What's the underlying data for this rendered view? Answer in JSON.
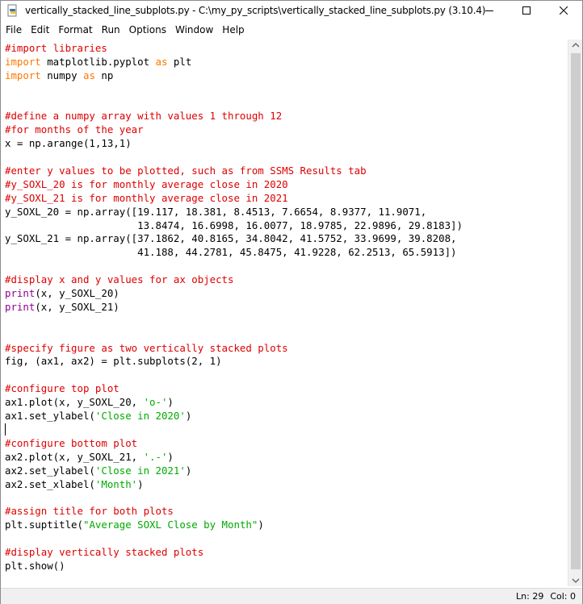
{
  "window": {
    "title": "vertically_stacked_line_subplots.py - C:\\my_py_scripts\\vertically_stacked_line_subplots.py (3.10.4)",
    "icon": "python-file-icon"
  },
  "menu": [
    {
      "id": "file",
      "label": "File"
    },
    {
      "id": "edit",
      "label": "Edit"
    },
    {
      "id": "format",
      "label": "Format"
    },
    {
      "id": "run",
      "label": "Run"
    },
    {
      "id": "options",
      "label": "Options"
    },
    {
      "id": "window",
      "label": "Window"
    },
    {
      "id": "help",
      "label": "Help"
    }
  ],
  "colors": {
    "comment": "#dd0000",
    "keyword": "#ff7700",
    "builtin": "#900090",
    "string": "#00aa00",
    "default": "#000000"
  },
  "code": [
    [
      [
        "comment",
        "#import libraries"
      ]
    ],
    [
      [
        "keyword",
        "import"
      ],
      [
        "default",
        " matplotlib.pyplot "
      ],
      [
        "keyword",
        "as"
      ],
      [
        "default",
        " plt"
      ]
    ],
    [
      [
        "keyword",
        "import"
      ],
      [
        "default",
        " numpy "
      ],
      [
        "keyword",
        "as"
      ],
      [
        "default",
        " np"
      ]
    ],
    [],
    [],
    [
      [
        "comment",
        "#define a numpy array with values 1 through 12"
      ]
    ],
    [
      [
        "comment",
        "#for months of the year"
      ]
    ],
    [
      [
        "default",
        "x = np.arange(1,13,1)"
      ]
    ],
    [],
    [
      [
        "comment",
        "#enter y values to be plotted, such as from SSMS Results tab"
      ]
    ],
    [
      [
        "comment",
        "#y_SOXL_20 is for monthly average close in 2020"
      ]
    ],
    [
      [
        "comment",
        "#y_SOXL_21 is for monthly average close in 2021"
      ]
    ],
    [
      [
        "default",
        "y_SOXL_20 = np.array([19.117, 18.381, 8.4513, 7.6654, 8.9377, 11.9071,"
      ]
    ],
    [
      [
        "default",
        "                      13.8474, 16.6998, 16.0077, 18.9785, 22.9896, 29.8183])"
      ]
    ],
    [
      [
        "default",
        "y_SOXL_21 = np.array([37.1862, 40.8165, 34.8042, 41.5752, 33.9699, 39.8208,"
      ]
    ],
    [
      [
        "default",
        "                      41.188, 44.2781, 45.8475, 41.9228, 62.2513, 65.5913])"
      ]
    ],
    [],
    [
      [
        "comment",
        "#display x and y values for ax objects"
      ]
    ],
    [
      [
        "builtin",
        "print"
      ],
      [
        "default",
        "(x, y_SOXL_20)"
      ]
    ],
    [
      [
        "builtin",
        "print"
      ],
      [
        "default",
        "(x, y_SOXL_21)"
      ]
    ],
    [],
    [],
    [
      [
        "comment",
        "#specify figure as two vertically stacked plots"
      ]
    ],
    [
      [
        "default",
        "fig, (ax1, ax2) = plt.subplots(2, 1)"
      ]
    ],
    [],
    [
      [
        "comment",
        "#configure top plot"
      ]
    ],
    [
      [
        "default",
        "ax1.plot(x, y_SOXL_20, "
      ],
      [
        "string",
        "'o-'"
      ],
      [
        "default",
        ")"
      ]
    ],
    [
      [
        "default",
        "ax1.set_ylabel("
      ],
      [
        "string",
        "'Close in 2020'"
      ],
      [
        "default",
        ")"
      ]
    ],
    [
      [
        "caret",
        ""
      ]
    ],
    [
      [
        "comment",
        "#configure bottom plot"
      ]
    ],
    [
      [
        "default",
        "ax2.plot(x, y_SOXL_21, "
      ],
      [
        "string",
        "'.-'"
      ],
      [
        "default",
        ")"
      ]
    ],
    [
      [
        "default",
        "ax2.set_ylabel("
      ],
      [
        "string",
        "'Close in 2021'"
      ],
      [
        "default",
        ")"
      ]
    ],
    [
      [
        "default",
        "ax2.set_xlabel("
      ],
      [
        "string",
        "'Month'"
      ],
      [
        "default",
        ")"
      ]
    ],
    [],
    [
      [
        "comment",
        "#assign title for both plots"
      ]
    ],
    [
      [
        "default",
        "plt.suptitle("
      ],
      [
        "string",
        "\"Average SOXL Close by Month\""
      ],
      [
        "default",
        ")"
      ]
    ],
    [],
    [
      [
        "comment",
        "#display vertically stacked plots"
      ]
    ],
    [
      [
        "default",
        "plt.show()"
      ]
    ]
  ],
  "status": {
    "line": "Ln: 29",
    "col": "Col: 0"
  }
}
